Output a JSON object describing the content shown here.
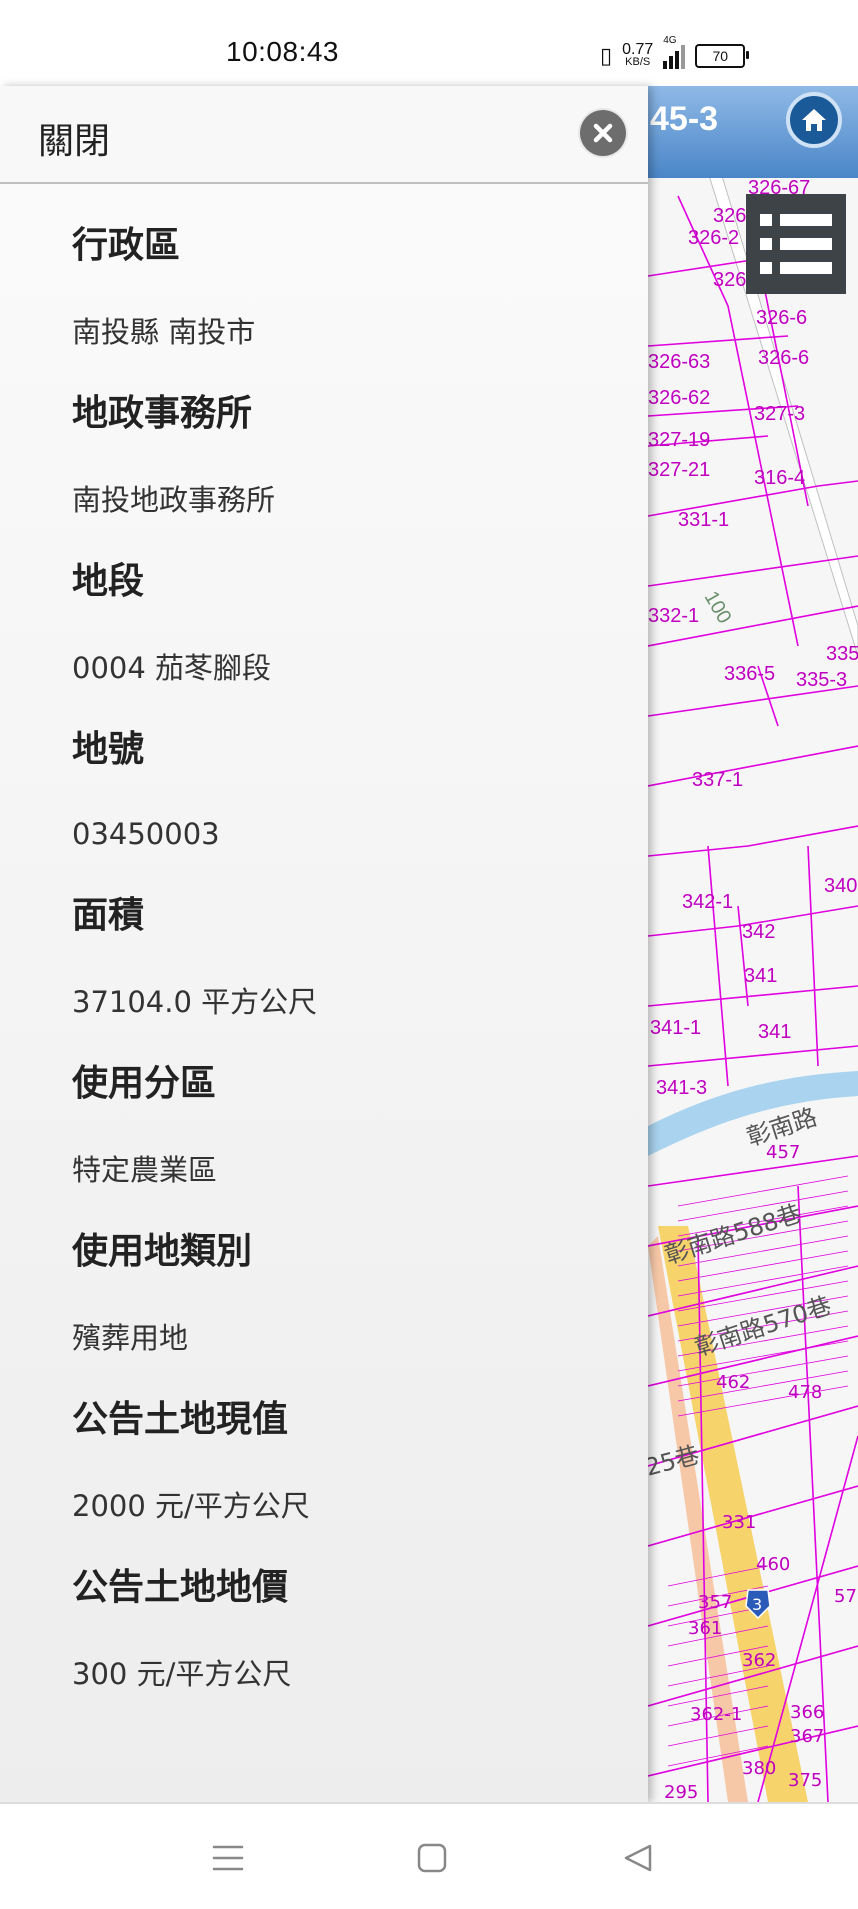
{
  "status_bar": {
    "time": "10:08:43",
    "net_speed_value": "0.77",
    "net_speed_unit": "KB/S",
    "network_type": "4G",
    "battery_level": "70"
  },
  "map": {
    "title": "45-3",
    "parcel_labels": [
      "326-67",
      "326",
      "326-2",
      "326",
      "326-6",
      "326-6",
      "326-63",
      "326-62",
      "327-19",
      "327-21",
      "327-3",
      "316-4",
      "331-1",
      "332-1",
      "100",
      "336-5",
      "335-3",
      "335",
      "337-1",
      "340",
      "342-1",
      "342",
      "341",
      "341-1",
      "341",
      "341-3",
      "彰南路",
      "457",
      "彰南路588巷",
      "彰南路570巷",
      "462",
      "478",
      "25巷",
      "331",
      "460",
      "357",
      "361",
      "362",
      "362-1",
      "366",
      "367",
      "380",
      "375",
      "295",
      "57",
      "3"
    ]
  },
  "drawer": {
    "close_label": "關閉",
    "fields": [
      {
        "title": "行政區",
        "value": "南投縣 南投市"
      },
      {
        "title": "地政事務所",
        "value": "南投地政事務所"
      },
      {
        "title": "地段",
        "value": "0004 茄苳腳段"
      },
      {
        "title": "地號",
        "value": "03450003"
      },
      {
        "title": "面積",
        "value": "37104.0 平方公尺"
      },
      {
        "title": "使用分區",
        "value": "特定農業區"
      },
      {
        "title": "使用地類別",
        "value": "殯葬用地"
      },
      {
        "title": "公告土地現值",
        "value": "2000 元/平方公尺"
      },
      {
        "title": "公告土地地價",
        "value": "300 元/平方公尺"
      }
    ]
  },
  "colors": {
    "parcel_line": "#e000e0",
    "header_blue": "#4a86c8",
    "road_yellow": "#f6d36b",
    "river_blue": "#a9d3ee"
  },
  "icons": [
    "close-icon",
    "home-icon",
    "layers-menu-icon",
    "menu-icon",
    "home-square-icon",
    "back-icon",
    "vibrate-icon",
    "signal-icon",
    "battery-icon"
  ]
}
